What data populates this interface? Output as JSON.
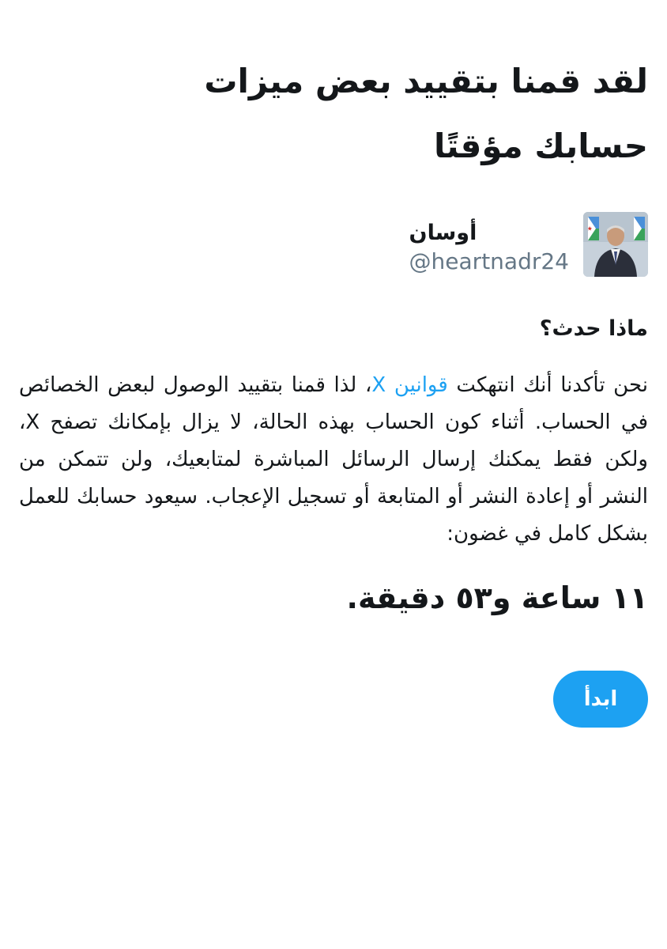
{
  "title": "لقد قمنا بتقييد بعض ميزات حسابك مؤقتًا",
  "profile": {
    "name": "أوسان",
    "handle": "@heartnadr24"
  },
  "section_heading": "ماذا حدث؟",
  "body": {
    "part1": "نحن تأكدنا أنك انتهكت ",
    "link_text": "قوانين X",
    "part2": "، لذا قمنا بتقييد الوصول لبعض الخصائص في الحساب. أثناء كون الحساب بهذه الحالة، لا يزال بإمكانك تصفح X، ولكن فقط يمكنك إرسال الرسائل المباشرة لمتابعيك، ولن تتمكن من النشر أو إعادة النشر أو المتابعة أو تسجيل الإعجاب. سيعود حسابك للعمل بشكل كامل في غضون:"
  },
  "countdown": "١١ ساعة و٥٣ دقيقة.",
  "button_label": "ابدأ",
  "colors": {
    "accent": "#1da1f2",
    "text": "#14171a",
    "muted": "#657786",
    "background": "#ffffff"
  }
}
